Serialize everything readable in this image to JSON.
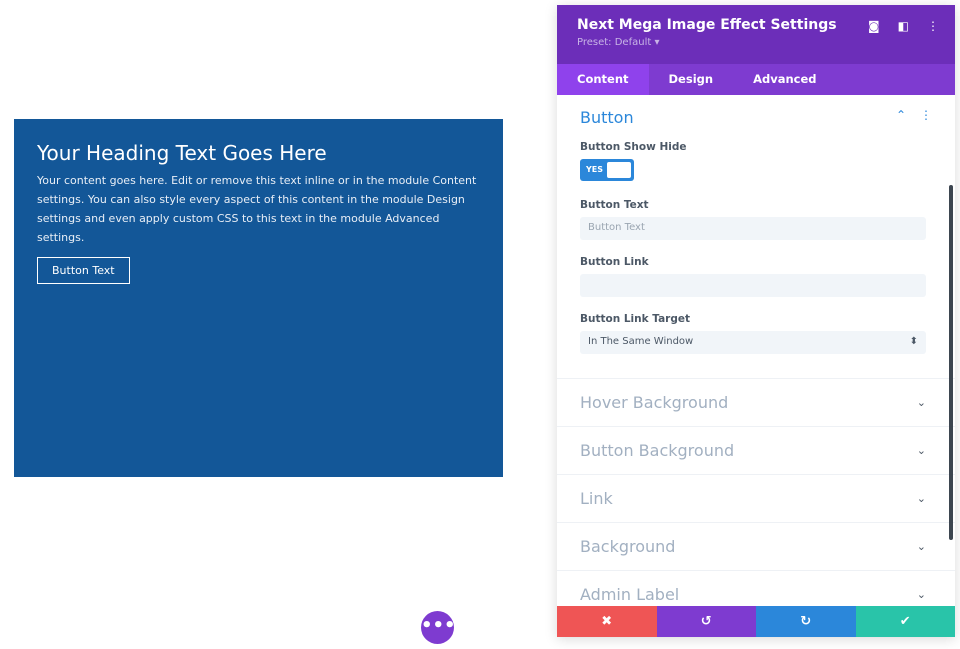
{
  "module": {
    "heading": "Your Heading Text Goes Here",
    "body": "Your content goes here. Edit or remove this text inline or in the module Content settings. You can also style every aspect of this content in the module Design settings and even apply custom CSS to this text in the module Advanced settings.",
    "button": "Button Text"
  },
  "fab": {
    "icon": "more-horizontal-icon",
    "label": "•••"
  },
  "panel": {
    "title": "Next Mega Image Effect Settings",
    "preset": "Preset: Default ▾",
    "header_icons": {
      "focus": "◙",
      "sidebar": "◧",
      "more": "⋮"
    },
    "tabs": [
      "Content",
      "Design",
      "Advanced"
    ],
    "section": {
      "title": "Button",
      "collapse": "⌃",
      "more": "⋮",
      "show_hide_label": "Button Show Hide",
      "toggle": "YES",
      "text_label": "Button Text",
      "text_placeholder": "Button Text",
      "link_label": "Button Link",
      "link_value": "",
      "target_label": "Button Link Target",
      "target_value": "In The Same Window",
      "target_arrows": "⬍"
    },
    "closed_sections": [
      "Hover Background",
      "Button Background",
      "Link",
      "Background",
      "Admin Label"
    ],
    "chevron": "⌄",
    "footer": {
      "cancel": "✖",
      "undo": "↺",
      "redo": "↻",
      "save": "✔"
    },
    "colors": {
      "header": "#6c2eb9",
      "tabs": "#7e3bd0",
      "cancel": "#ef5555",
      "undo": "#7e3bd0",
      "redo": "#2b87da",
      "save": "#29c4a9"
    }
  }
}
